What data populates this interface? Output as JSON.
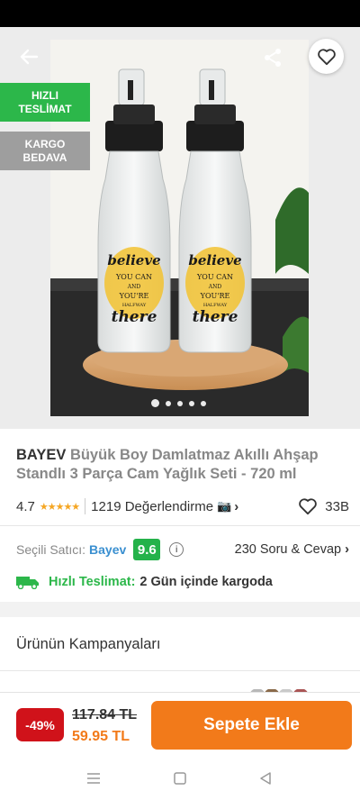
{
  "product": {
    "brand": "BAYEV",
    "name": "Büyük Boy Damlatmaz Akıllı Ahşap Standlı 3 Parça Cam Yağlık Seti - 720 ml"
  },
  "badges": {
    "fast_delivery": "HIZLI TESLİMAT",
    "free_cargo": "KARGO BEDAVA"
  },
  "image_text": {
    "line1": "believe",
    "line2": "YOU CAN",
    "line3": "AND",
    "line4": "YOU'RE",
    "line5": "HALFWAY",
    "line6": "there"
  },
  "gallery": {
    "total_images": 5,
    "active_index": 0
  },
  "rating": {
    "score": "4.7",
    "stars_value": 4.7,
    "review_count": "1219 Değerlendirme",
    "likes": "33B"
  },
  "seller": {
    "label": "Seçili Satıcı:",
    "name": "Bayev",
    "score": "9.6",
    "qa": "230 Soru & Cevap"
  },
  "delivery": {
    "label": "Hızlı Teslimat:",
    "text": "2 Gün içinde kargoda"
  },
  "campaigns": {
    "title": "Ürünün Kampanyaları"
  },
  "purchase": {
    "discount": "-49%",
    "old_price": "117.84 TL",
    "new_price": "59.95 TL",
    "add_to_cart": "Sepete Ekle"
  },
  "colors": {
    "orange": "#f27a1a",
    "green": "#2cb74a",
    "discount_red": "#d0121a",
    "seller_blue": "#3a8fd0"
  },
  "icons": [
    "back-arrow-icon",
    "share-icon",
    "heart-icon",
    "info-icon",
    "truck-icon",
    "camera-icon",
    "chevron-right-icon",
    "menu-icon",
    "home-square-icon",
    "back-triangle-icon"
  ]
}
